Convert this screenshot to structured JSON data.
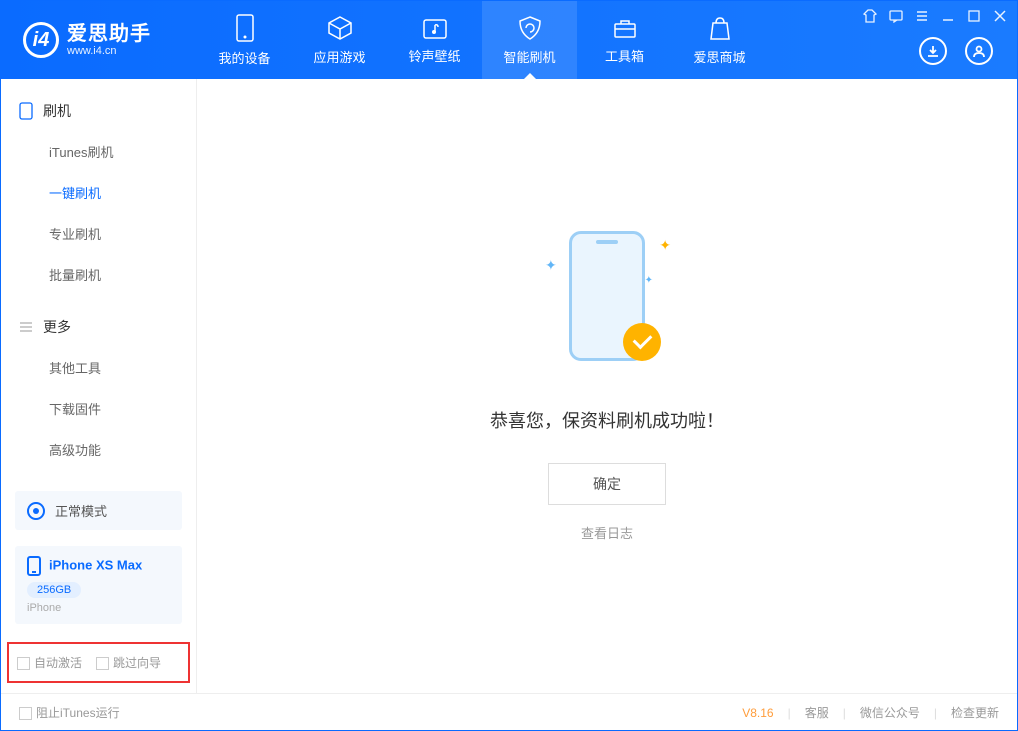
{
  "app": {
    "name_cn": "爱思助手",
    "url": "www.i4.cn"
  },
  "nav": {
    "device": "我的设备",
    "apps": "应用游戏",
    "ringtone": "铃声壁纸",
    "flash": "智能刷机",
    "toolbox": "工具箱",
    "store": "爱思商城"
  },
  "sidebar": {
    "section_flash": "刷机",
    "items_flash": {
      "itunes": "iTunes刷机",
      "oneclick": "一键刷机",
      "pro": "专业刷机",
      "batch": "批量刷机"
    },
    "section_more": "更多",
    "items_more": {
      "other": "其他工具",
      "firmware": "下载固件",
      "advanced": "高级功能"
    },
    "mode": "正常模式",
    "device_name": "iPhone XS Max",
    "storage": "256GB",
    "device_type": "iPhone",
    "cb_auto_activate": "自动激活",
    "cb_skip_guide": "跳过向导"
  },
  "main": {
    "success": "恭喜您，保资料刷机成功啦！",
    "ok": "确定",
    "view_log": "查看日志"
  },
  "footer": {
    "block_itunes": "阻止iTunes运行",
    "version": "V8.16",
    "support": "客服",
    "wechat": "微信公众号",
    "update": "检查更新"
  }
}
